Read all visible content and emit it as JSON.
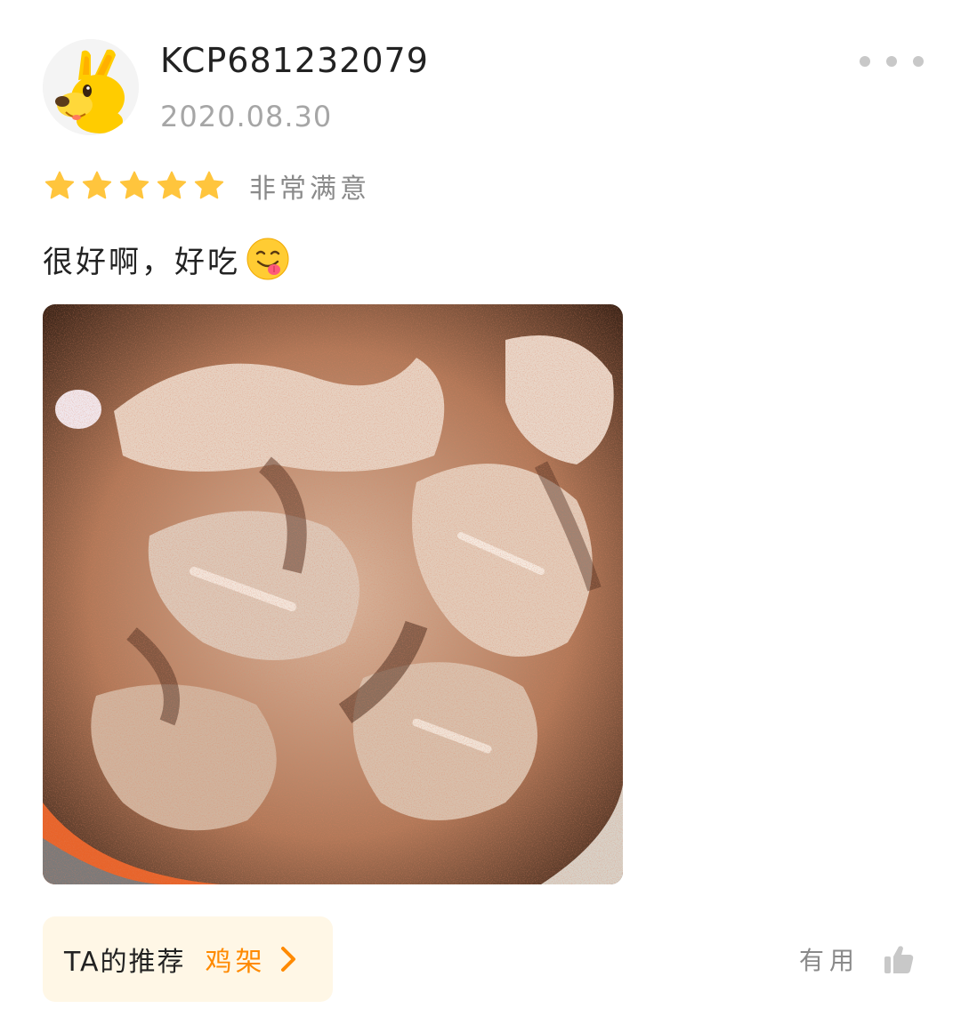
{
  "user": {
    "avatar": "kangaroo-mascot-avatar",
    "name": "KCP681232079",
    "date": "2020.08.30"
  },
  "more_menu": {
    "icon": "more-dots-icon"
  },
  "rating": {
    "value": 5,
    "max": 5,
    "label": "非常满意",
    "star_color": "#ffc53d"
  },
  "review": {
    "text": "很好啊，好吃",
    "emoji": "yum-face-emoji"
  },
  "photo": {
    "subject": "seasoned chicken rack photo"
  },
  "recommend": {
    "label": "TA的推荐",
    "item": "鸡架",
    "accent_color": "#ff8a00",
    "background": "#fff7e6"
  },
  "useful": {
    "label": "有用",
    "icon": "thumbs-up-icon"
  }
}
